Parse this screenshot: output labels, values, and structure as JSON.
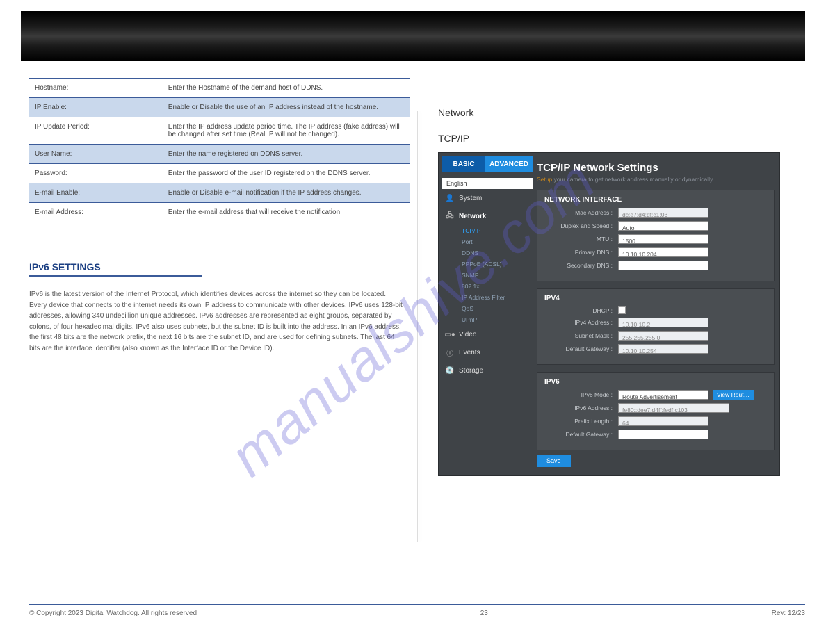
{
  "table": [
    {
      "label": "Hostname:",
      "desc": "Enter the Hostname of the demand host of DDNS.",
      "hl": false
    },
    {
      "label": "IP Enable:",
      "desc": "Enable or Disable the use of an IP address instead of the hostname.",
      "hl": true
    },
    {
      "label": "IP Update Period:",
      "desc": "Enter the IP address update period time. The IP address (fake address) will be changed after set time (Real IP will not be changed).",
      "hl": false
    },
    {
      "label": "User Name:",
      "desc": "Enter the name registered on DDNS server.",
      "hl": true
    },
    {
      "label": "Password:",
      "desc": "Enter the password of the user ID registered on the DDNS server.",
      "hl": false
    },
    {
      "label": "E-mail Enable:",
      "desc": "Enable or Disable e-mail notification if the IP address changes.",
      "hl": true
    },
    {
      "label": "E-mail Address:",
      "desc": "Enter the e-mail address that will receive the notification.",
      "hl": false
    }
  ],
  "ipv6": {
    "heading": "IPv6 SETTINGS",
    "text": "IPv6 is the latest version of the Internet Protocol, which identifies devices across the internet so they can be located. Every device that connects to the internet needs its own IP address to communicate with other devices. IPv6 uses 128-bit addresses, allowing 340 undecillion unique addresses. IPv6 addresses are represented as eight groups, separated by colons, of four hexadecimal digits. IPv6 also uses subnets, but the subnet ID is built into the address. In an IPv6 address, the first 48 bits are the network prefix, the next 16 bits are the subnet ID, and are used for defining subnets. The last 64 bits are the interface identifier (also known as the Interface ID or the Device ID)."
  },
  "right": {
    "network_label": "Network",
    "tcpip_label": "TCP/IP",
    "panel": {
      "tab_basic": "BASIC",
      "tab_advanced": "ADVANCED",
      "lang": "English",
      "nav": {
        "system": "System",
        "network": "Network",
        "video": "Video",
        "events": "Events",
        "storage": "Storage",
        "sub": [
          "TCP/IP",
          "Port",
          "DDNS",
          "PPPoE (ADSL)",
          "SNMP",
          "802.1x",
          "IP Address Filter",
          "QoS",
          "UPnP"
        ]
      },
      "title": "TCP/IP Network Settings",
      "subtitle_pre": "Setup",
      "subtitle_rest": "your camera to get network address manually or dynamically.",
      "cards": {
        "iface": {
          "title": "NETWORK INTERFACE",
          "mac_label": "Mac Address :",
          "mac": "dc:e7:d4:df:c1:03",
          "dup_label": "Duplex and Speed :",
          "dup": "Auto",
          "mtu_label": "MTU :",
          "mtu": "1500",
          "pdns_label": "Primary DNS :",
          "pdns": "10.10.10.204",
          "sdns_label": "Secondary DNS :",
          "sdns": ""
        },
        "ipv4": {
          "title": "IPV4",
          "dhcp_label": "DHCP :",
          "addr_label": "IPv4 Address :",
          "addr": "10.10.10.2",
          "mask_label": "Subnet Mask :",
          "mask": "255.255.255.0",
          "gw_label": "Default Gateway :",
          "gw": "10.10.10.254"
        },
        "ipv6": {
          "title": "IPV6",
          "mode_label": "IPv6 Mode :",
          "mode": "Route Advertisement",
          "view": "View Rout…",
          "addr_label": "IPv6 Address :",
          "addr": "fe80::dee7:d4ff:fedf:c103",
          "plen_label": "Prefix Length :",
          "plen": "64",
          "gw_label": "Default Gateway :",
          "gw": ""
        }
      },
      "save": "Save"
    }
  },
  "footer": {
    "copy": "© Copyright 2023 Digital Watchdog. All rights reserved",
    "page": "23",
    "rev": "Rev: 12/23"
  },
  "watermark": "manualshive.com"
}
